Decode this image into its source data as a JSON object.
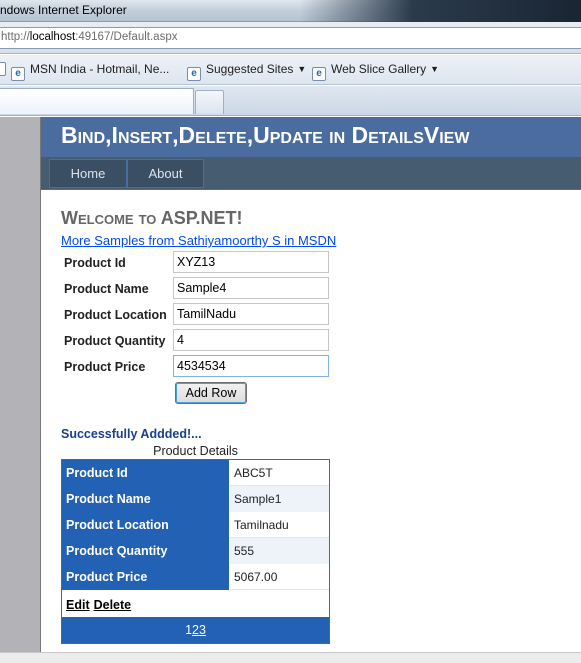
{
  "browser": {
    "window_title": "ndows Internet Explorer",
    "url_prefix": "http://",
    "url_host": "localhost",
    "url_rest": ":49167/Default.aspx",
    "favorites": [
      {
        "label": "MSN India - Hotmail, Ne..."
      },
      {
        "label": "Suggested Sites"
      },
      {
        "label": "Web Slice Gallery"
      }
    ]
  },
  "site": {
    "title": "Bind,Insert,Delete,Update in DetailsView",
    "menu": [
      {
        "label": "Home"
      },
      {
        "label": "About"
      }
    ]
  },
  "main": {
    "welcome": "Welcome to ASP.NET!",
    "samples_link": "More Samples from Sathiyamoorthy S in MSDN",
    "form": {
      "fields": [
        {
          "label": "Product Id",
          "value": "XYZ13"
        },
        {
          "label": "Product Name",
          "value": "Sample4"
        },
        {
          "label": "Product Location",
          "value": "TamilNadu"
        },
        {
          "label": "Product Quantity",
          "value": "4"
        },
        {
          "label": "Product Price",
          "value": "4534534"
        }
      ],
      "add_button": "Add Row"
    },
    "success_message": "Successfully Addded!...",
    "details": {
      "caption": "Product Details",
      "rows": [
        {
          "label": "Product Id",
          "value": "ABC5T"
        },
        {
          "label": "Product Name",
          "value": "Sample1"
        },
        {
          "label": "Product Location",
          "value": "Tamilnadu"
        },
        {
          "label": "Product Quantity",
          "value": "555"
        },
        {
          "label": "Product Price",
          "value": "5067.00"
        }
      ],
      "edit_label": "Edit",
      "delete_label": "Delete",
      "pager": {
        "current": "1",
        "pages": [
          "2",
          "3"
        ]
      }
    }
  },
  "colors": {
    "header_bg": "#4b6c9e",
    "menu_bg": "#465c71",
    "details_header": "#2361b4",
    "link": "#034af3"
  }
}
